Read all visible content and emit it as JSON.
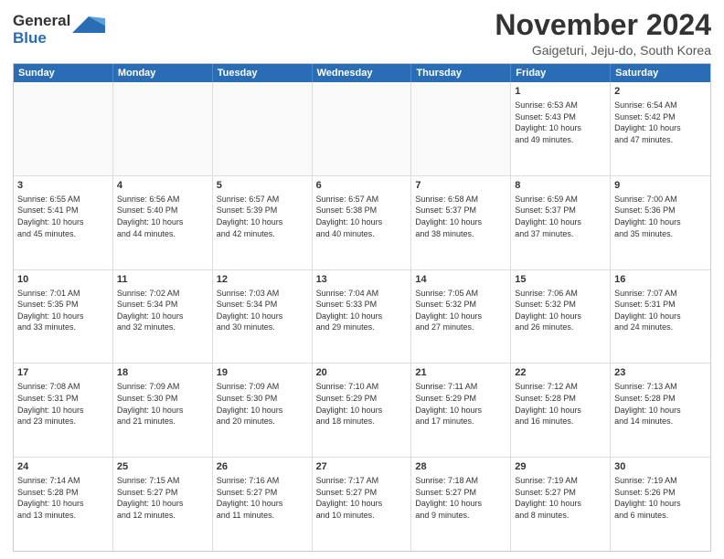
{
  "logo": {
    "line1": "General",
    "line2": "Blue"
  },
  "title": "November 2024",
  "subtitle": "Gaigeturi, Jeju-do, South Korea",
  "headers": [
    "Sunday",
    "Monday",
    "Tuesday",
    "Wednesday",
    "Thursday",
    "Friday",
    "Saturday"
  ],
  "weeks": [
    [
      {
        "day": "",
        "text": "",
        "empty": true
      },
      {
        "day": "",
        "text": "",
        "empty": true
      },
      {
        "day": "",
        "text": "",
        "empty": true
      },
      {
        "day": "",
        "text": "",
        "empty": true
      },
      {
        "day": "",
        "text": "",
        "empty": true
      },
      {
        "day": "1",
        "text": "Sunrise: 6:53 AM\nSunset: 5:43 PM\nDaylight: 10 hours\nand 49 minutes.",
        "empty": false
      },
      {
        "day": "2",
        "text": "Sunrise: 6:54 AM\nSunset: 5:42 PM\nDaylight: 10 hours\nand 47 minutes.",
        "empty": false
      }
    ],
    [
      {
        "day": "3",
        "text": "Sunrise: 6:55 AM\nSunset: 5:41 PM\nDaylight: 10 hours\nand 45 minutes.",
        "empty": false
      },
      {
        "day": "4",
        "text": "Sunrise: 6:56 AM\nSunset: 5:40 PM\nDaylight: 10 hours\nand 44 minutes.",
        "empty": false
      },
      {
        "day": "5",
        "text": "Sunrise: 6:57 AM\nSunset: 5:39 PM\nDaylight: 10 hours\nand 42 minutes.",
        "empty": false
      },
      {
        "day": "6",
        "text": "Sunrise: 6:57 AM\nSunset: 5:38 PM\nDaylight: 10 hours\nand 40 minutes.",
        "empty": false
      },
      {
        "day": "7",
        "text": "Sunrise: 6:58 AM\nSunset: 5:37 PM\nDaylight: 10 hours\nand 38 minutes.",
        "empty": false
      },
      {
        "day": "8",
        "text": "Sunrise: 6:59 AM\nSunset: 5:37 PM\nDaylight: 10 hours\nand 37 minutes.",
        "empty": false
      },
      {
        "day": "9",
        "text": "Sunrise: 7:00 AM\nSunset: 5:36 PM\nDaylight: 10 hours\nand 35 minutes.",
        "empty": false
      }
    ],
    [
      {
        "day": "10",
        "text": "Sunrise: 7:01 AM\nSunset: 5:35 PM\nDaylight: 10 hours\nand 33 minutes.",
        "empty": false
      },
      {
        "day": "11",
        "text": "Sunrise: 7:02 AM\nSunset: 5:34 PM\nDaylight: 10 hours\nand 32 minutes.",
        "empty": false
      },
      {
        "day": "12",
        "text": "Sunrise: 7:03 AM\nSunset: 5:34 PM\nDaylight: 10 hours\nand 30 minutes.",
        "empty": false
      },
      {
        "day": "13",
        "text": "Sunrise: 7:04 AM\nSunset: 5:33 PM\nDaylight: 10 hours\nand 29 minutes.",
        "empty": false
      },
      {
        "day": "14",
        "text": "Sunrise: 7:05 AM\nSunset: 5:32 PM\nDaylight: 10 hours\nand 27 minutes.",
        "empty": false
      },
      {
        "day": "15",
        "text": "Sunrise: 7:06 AM\nSunset: 5:32 PM\nDaylight: 10 hours\nand 26 minutes.",
        "empty": false
      },
      {
        "day": "16",
        "text": "Sunrise: 7:07 AM\nSunset: 5:31 PM\nDaylight: 10 hours\nand 24 minutes.",
        "empty": false
      }
    ],
    [
      {
        "day": "17",
        "text": "Sunrise: 7:08 AM\nSunset: 5:31 PM\nDaylight: 10 hours\nand 23 minutes.",
        "empty": false
      },
      {
        "day": "18",
        "text": "Sunrise: 7:09 AM\nSunset: 5:30 PM\nDaylight: 10 hours\nand 21 minutes.",
        "empty": false
      },
      {
        "day": "19",
        "text": "Sunrise: 7:09 AM\nSunset: 5:30 PM\nDaylight: 10 hours\nand 20 minutes.",
        "empty": false
      },
      {
        "day": "20",
        "text": "Sunrise: 7:10 AM\nSunset: 5:29 PM\nDaylight: 10 hours\nand 18 minutes.",
        "empty": false
      },
      {
        "day": "21",
        "text": "Sunrise: 7:11 AM\nSunset: 5:29 PM\nDaylight: 10 hours\nand 17 minutes.",
        "empty": false
      },
      {
        "day": "22",
        "text": "Sunrise: 7:12 AM\nSunset: 5:28 PM\nDaylight: 10 hours\nand 16 minutes.",
        "empty": false
      },
      {
        "day": "23",
        "text": "Sunrise: 7:13 AM\nSunset: 5:28 PM\nDaylight: 10 hours\nand 14 minutes.",
        "empty": false
      }
    ],
    [
      {
        "day": "24",
        "text": "Sunrise: 7:14 AM\nSunset: 5:28 PM\nDaylight: 10 hours\nand 13 minutes.",
        "empty": false
      },
      {
        "day": "25",
        "text": "Sunrise: 7:15 AM\nSunset: 5:27 PM\nDaylight: 10 hours\nand 12 minutes.",
        "empty": false
      },
      {
        "day": "26",
        "text": "Sunrise: 7:16 AM\nSunset: 5:27 PM\nDaylight: 10 hours\nand 11 minutes.",
        "empty": false
      },
      {
        "day": "27",
        "text": "Sunrise: 7:17 AM\nSunset: 5:27 PM\nDaylight: 10 hours\nand 10 minutes.",
        "empty": false
      },
      {
        "day": "28",
        "text": "Sunrise: 7:18 AM\nSunset: 5:27 PM\nDaylight: 10 hours\nand 9 minutes.",
        "empty": false
      },
      {
        "day": "29",
        "text": "Sunrise: 7:19 AM\nSunset: 5:27 PM\nDaylight: 10 hours\nand 8 minutes.",
        "empty": false
      },
      {
        "day": "30",
        "text": "Sunrise: 7:19 AM\nSunset: 5:26 PM\nDaylight: 10 hours\nand 6 minutes.",
        "empty": false
      }
    ]
  ]
}
